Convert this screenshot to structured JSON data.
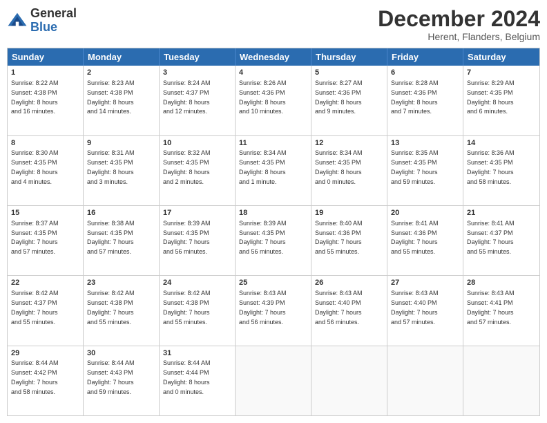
{
  "logo": {
    "line1": "General",
    "line2": "Blue"
  },
  "title": "December 2024",
  "subtitle": "Herent, Flanders, Belgium",
  "header_days": [
    "Sunday",
    "Monday",
    "Tuesday",
    "Wednesday",
    "Thursday",
    "Friday",
    "Saturday"
  ],
  "rows": [
    [
      {
        "day": "1",
        "text": "Sunrise: 8:22 AM\nSunset: 4:38 PM\nDaylight: 8 hours\nand 16 minutes."
      },
      {
        "day": "2",
        "text": "Sunrise: 8:23 AM\nSunset: 4:38 PM\nDaylight: 8 hours\nand 14 minutes."
      },
      {
        "day": "3",
        "text": "Sunrise: 8:24 AM\nSunset: 4:37 PM\nDaylight: 8 hours\nand 12 minutes."
      },
      {
        "day": "4",
        "text": "Sunrise: 8:26 AM\nSunset: 4:36 PM\nDaylight: 8 hours\nand 10 minutes."
      },
      {
        "day": "5",
        "text": "Sunrise: 8:27 AM\nSunset: 4:36 PM\nDaylight: 8 hours\nand 9 minutes."
      },
      {
        "day": "6",
        "text": "Sunrise: 8:28 AM\nSunset: 4:36 PM\nDaylight: 8 hours\nand 7 minutes."
      },
      {
        "day": "7",
        "text": "Sunrise: 8:29 AM\nSunset: 4:35 PM\nDaylight: 8 hours\nand 6 minutes."
      }
    ],
    [
      {
        "day": "8",
        "text": "Sunrise: 8:30 AM\nSunset: 4:35 PM\nDaylight: 8 hours\nand 4 minutes."
      },
      {
        "day": "9",
        "text": "Sunrise: 8:31 AM\nSunset: 4:35 PM\nDaylight: 8 hours\nand 3 minutes."
      },
      {
        "day": "10",
        "text": "Sunrise: 8:32 AM\nSunset: 4:35 PM\nDaylight: 8 hours\nand 2 minutes."
      },
      {
        "day": "11",
        "text": "Sunrise: 8:34 AM\nSunset: 4:35 PM\nDaylight: 8 hours\nand 1 minute."
      },
      {
        "day": "12",
        "text": "Sunrise: 8:34 AM\nSunset: 4:35 PM\nDaylight: 8 hours\nand 0 minutes."
      },
      {
        "day": "13",
        "text": "Sunrise: 8:35 AM\nSunset: 4:35 PM\nDaylight: 7 hours\nand 59 minutes."
      },
      {
        "day": "14",
        "text": "Sunrise: 8:36 AM\nSunset: 4:35 PM\nDaylight: 7 hours\nand 58 minutes."
      }
    ],
    [
      {
        "day": "15",
        "text": "Sunrise: 8:37 AM\nSunset: 4:35 PM\nDaylight: 7 hours\nand 57 minutes."
      },
      {
        "day": "16",
        "text": "Sunrise: 8:38 AM\nSunset: 4:35 PM\nDaylight: 7 hours\nand 57 minutes."
      },
      {
        "day": "17",
        "text": "Sunrise: 8:39 AM\nSunset: 4:35 PM\nDaylight: 7 hours\nand 56 minutes."
      },
      {
        "day": "18",
        "text": "Sunrise: 8:39 AM\nSunset: 4:35 PM\nDaylight: 7 hours\nand 56 minutes."
      },
      {
        "day": "19",
        "text": "Sunrise: 8:40 AM\nSunset: 4:36 PM\nDaylight: 7 hours\nand 55 minutes."
      },
      {
        "day": "20",
        "text": "Sunrise: 8:41 AM\nSunset: 4:36 PM\nDaylight: 7 hours\nand 55 minutes."
      },
      {
        "day": "21",
        "text": "Sunrise: 8:41 AM\nSunset: 4:37 PM\nDaylight: 7 hours\nand 55 minutes."
      }
    ],
    [
      {
        "day": "22",
        "text": "Sunrise: 8:42 AM\nSunset: 4:37 PM\nDaylight: 7 hours\nand 55 minutes."
      },
      {
        "day": "23",
        "text": "Sunrise: 8:42 AM\nSunset: 4:38 PM\nDaylight: 7 hours\nand 55 minutes."
      },
      {
        "day": "24",
        "text": "Sunrise: 8:42 AM\nSunset: 4:38 PM\nDaylight: 7 hours\nand 55 minutes."
      },
      {
        "day": "25",
        "text": "Sunrise: 8:43 AM\nSunset: 4:39 PM\nDaylight: 7 hours\nand 56 minutes."
      },
      {
        "day": "26",
        "text": "Sunrise: 8:43 AM\nSunset: 4:40 PM\nDaylight: 7 hours\nand 56 minutes."
      },
      {
        "day": "27",
        "text": "Sunrise: 8:43 AM\nSunset: 4:40 PM\nDaylight: 7 hours\nand 57 minutes."
      },
      {
        "day": "28",
        "text": "Sunrise: 8:43 AM\nSunset: 4:41 PM\nDaylight: 7 hours\nand 57 minutes."
      }
    ],
    [
      {
        "day": "29",
        "text": "Sunrise: 8:44 AM\nSunset: 4:42 PM\nDaylight: 7 hours\nand 58 minutes."
      },
      {
        "day": "30",
        "text": "Sunrise: 8:44 AM\nSunset: 4:43 PM\nDaylight: 7 hours\nand 59 minutes."
      },
      {
        "day": "31",
        "text": "Sunrise: 8:44 AM\nSunset: 4:44 PM\nDaylight: 8 hours\nand 0 minutes."
      },
      {
        "day": "",
        "text": ""
      },
      {
        "day": "",
        "text": ""
      },
      {
        "day": "",
        "text": ""
      },
      {
        "day": "",
        "text": ""
      }
    ]
  ]
}
